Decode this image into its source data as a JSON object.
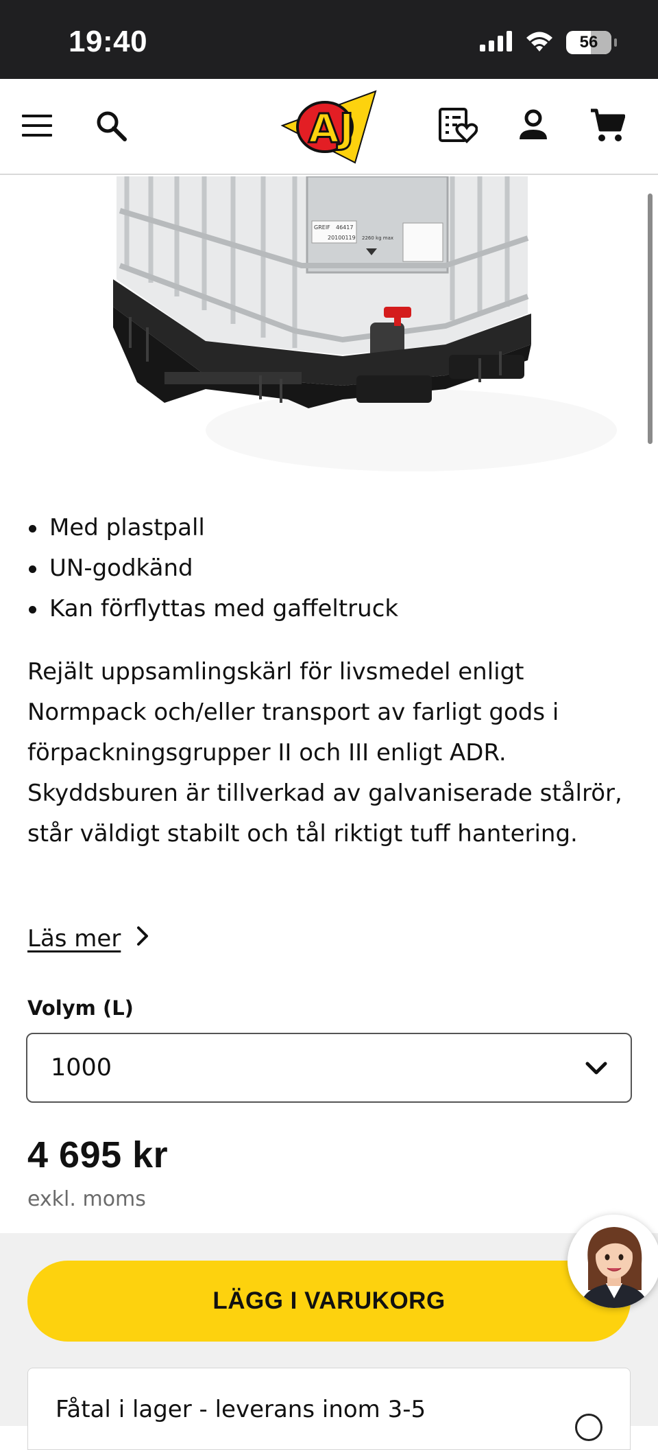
{
  "status_bar": {
    "time": "19:40",
    "battery": "56",
    "icons": [
      "cellular-signal-icon",
      "wifi-icon",
      "battery-icon"
    ]
  },
  "header": {
    "logo_text": "AJ",
    "icons": [
      "menu-icon",
      "search-icon",
      "wishlist-icon",
      "account-icon",
      "cart-icon"
    ]
  },
  "product": {
    "image_labels": {
      "label1": "GREIF",
      "label2": "46417",
      "label3": "20100119",
      "label4": "2260 kg max"
    },
    "features": [
      "Med plastpall",
      "UN-godkänd",
      "Kan förflyttas med gaffeltruck"
    ],
    "description": "Rejält uppsamlingskärl för livsmedel enligt Normpack och/eller transport av farligt gods i förpackningsgrupper II och III enligt ADR. Skyddsburen är tillverkad av galvaniserade stålrör, står väldigt stabilt och tål riktigt tuff hantering.",
    "read_more": "Läs mer",
    "volume_label": "Volym (L)",
    "volume_value": "1000",
    "price": "4 695 kr",
    "vat_note": "exkl. moms",
    "add_to_cart": "LÄGG I VARUKORG",
    "stock_text": "Fåtal i lager - leverans inom 3-5"
  },
  "colors": {
    "accent_yellow": "#fdd20e",
    "logo_red": "#e31e24",
    "status_bar_bg": "#1f1f21"
  }
}
